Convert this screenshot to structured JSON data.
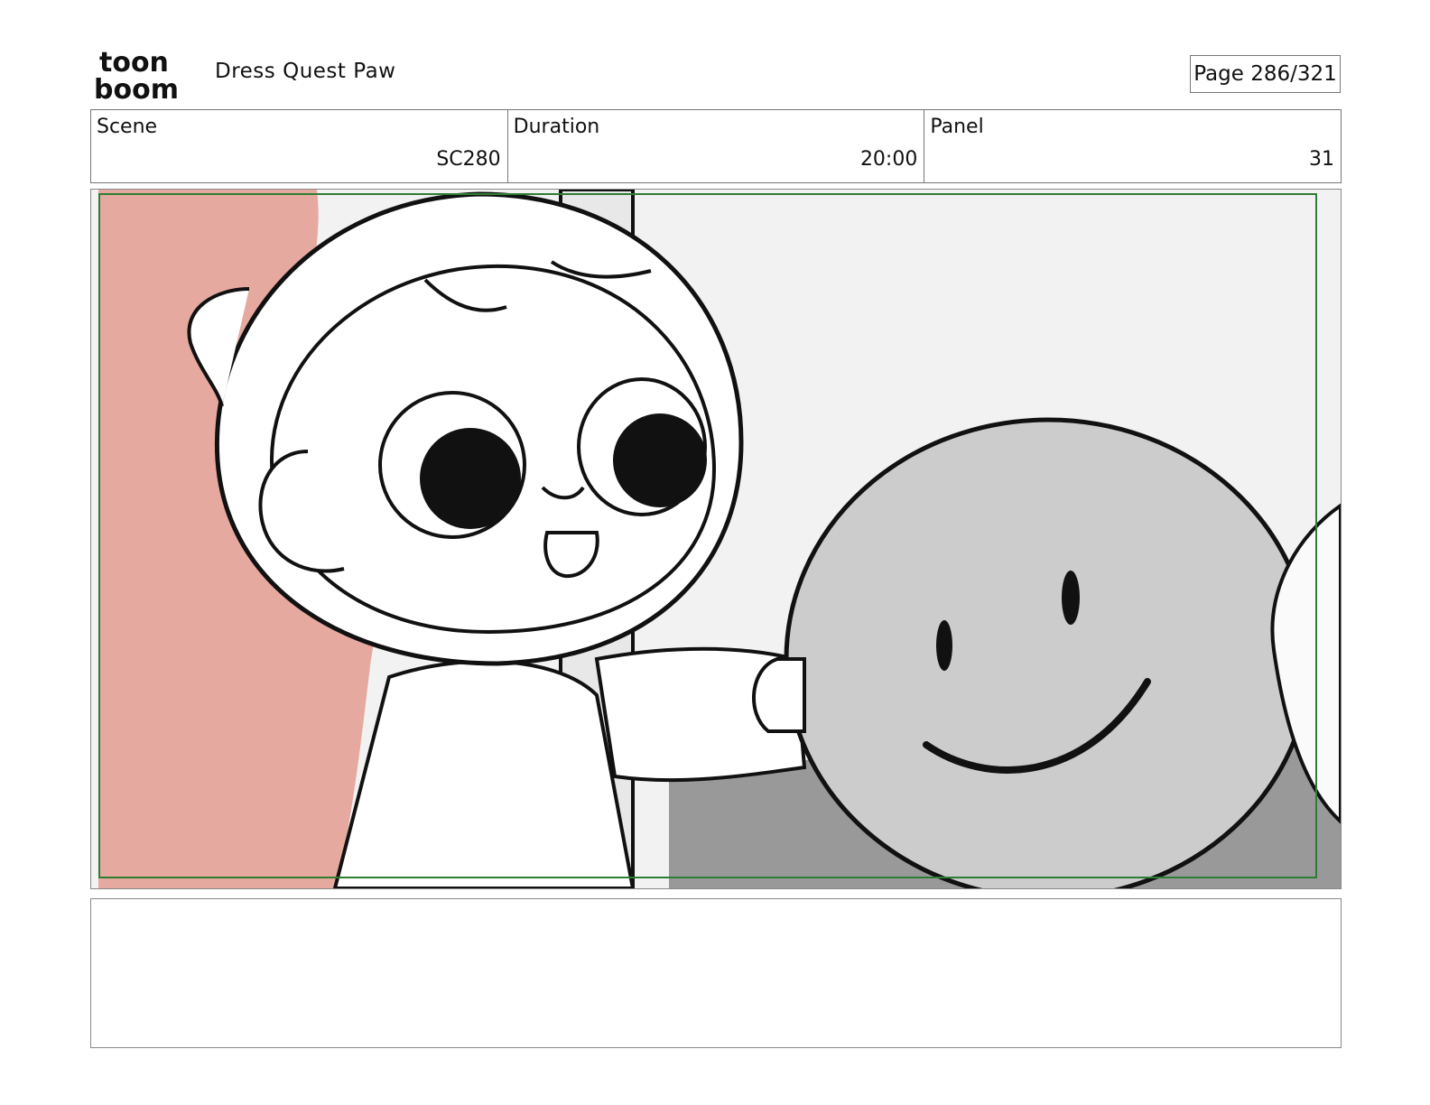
{
  "header": {
    "logo": {
      "line1": "toon",
      "line2": "boom"
    },
    "project_title": "Dress Quest Paw",
    "page_label": "Page 286/321"
  },
  "info": {
    "scene_label": "Scene",
    "scene_value": "SC280",
    "duration_label": "Duration",
    "duration_value": "20:00",
    "panel_label": "Panel",
    "panel_value": "31"
  },
  "colors": {
    "safe_frame": "#2e7d32",
    "pink_blob": "#e5a9a0",
    "ball_gray": "#cccccc",
    "wall_gray": "#f2f2f2",
    "dark_gray": "#999999",
    "yellow_accent": "#d8d36a"
  },
  "notes": {
    "text": ""
  }
}
